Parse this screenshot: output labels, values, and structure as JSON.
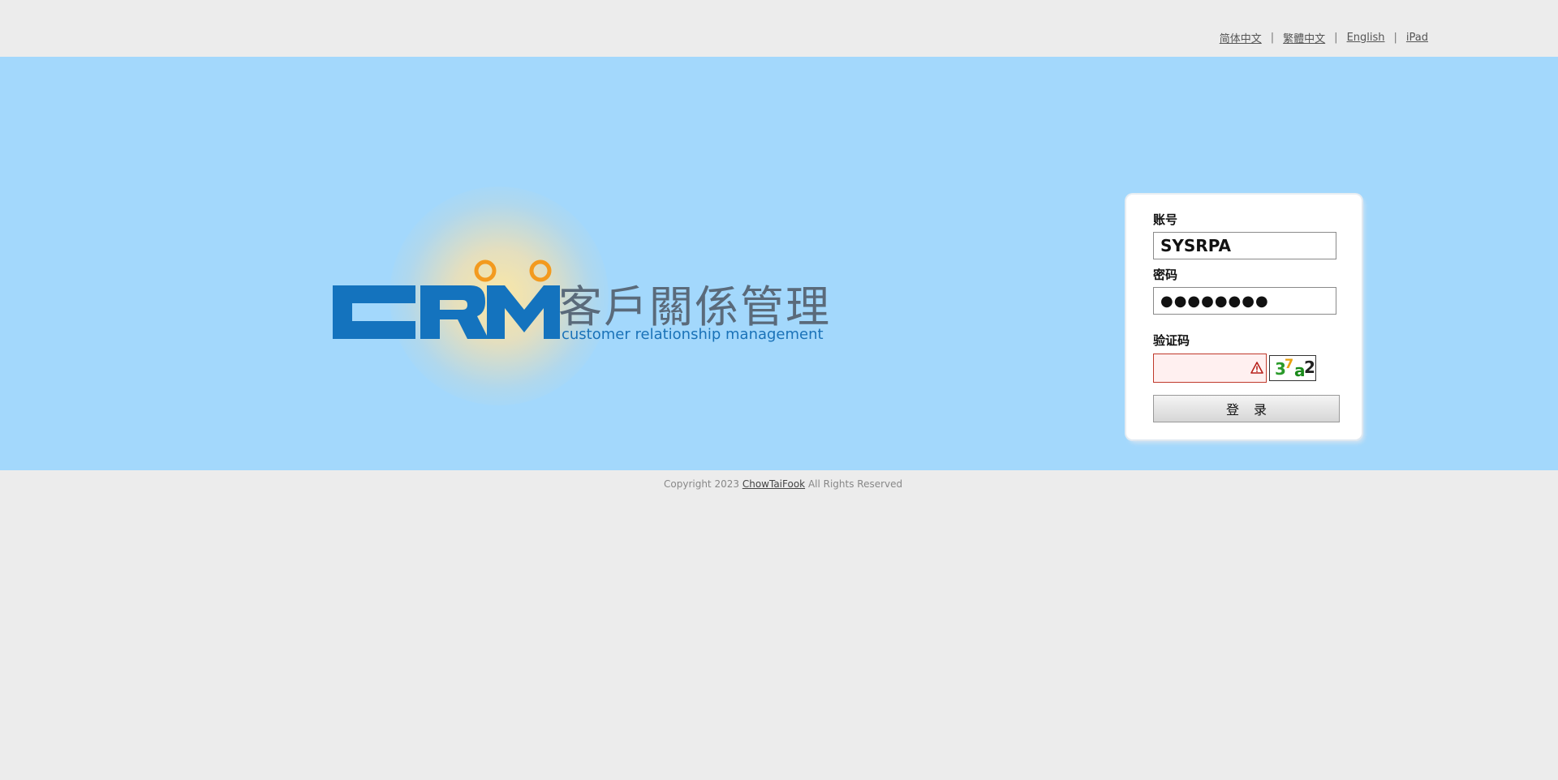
{
  "top_nav": {
    "languages": [
      {
        "label": "简体中文"
      },
      {
        "label": "繁體中文"
      },
      {
        "label": "English"
      },
      {
        "label": "iPad"
      }
    ],
    "separator": "|"
  },
  "logo": {
    "brand_letters": "CRM",
    "chinese_title": "客戶關係管理",
    "english_subtitle": "customer relationship management",
    "colors": {
      "crm_blue": "#1473be",
      "orange_rings": "#f39a1e",
      "title_gray": "#5a6a7a"
    }
  },
  "login": {
    "account_label": "账号",
    "account_value": "SYSRPA",
    "password_label": "密码",
    "password_mask": "●●●●●●●●",
    "captcha_label": "验证码",
    "captcha_value": "",
    "captcha_warning_icon": "warning-triangle-icon",
    "captcha_image_text": [
      "3",
      "7",
      "a",
      "2"
    ],
    "captcha_image_colors": [
      "#2a9a2a",
      "#e8a010",
      "#1a8a1a",
      "#222222"
    ],
    "submit_label": "登录"
  },
  "footer": {
    "prefix": "Copyright 2023",
    "company_link": "ChowTaiFook",
    "suffix": "All Rights Reserved"
  }
}
